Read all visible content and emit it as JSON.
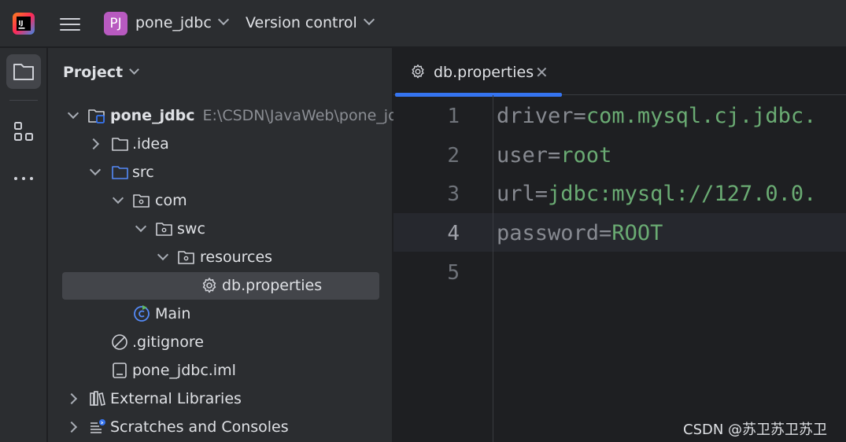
{
  "titlebar": {
    "project_badge": "PJ",
    "project_name": "pone_jdbc",
    "vcs_label": "Version control"
  },
  "stripe": {
    "items": [
      "project-folder-icon",
      "structure-icon",
      "more-icon"
    ]
  },
  "project_panel": {
    "title": "Project",
    "tree": [
      {
        "label": "pone_jdbc",
        "path": "E:\\CSDN\\JavaWeb\\pone_jdbc",
        "icon": "module-folder-icon",
        "expanded": true
      },
      {
        "label": ".idea",
        "icon": "folder-icon",
        "expanded": false
      },
      {
        "label": "src",
        "icon": "source-folder-icon",
        "expanded": true
      },
      {
        "label": "com",
        "icon": "package-icon",
        "expanded": true
      },
      {
        "label": "swc",
        "icon": "package-icon",
        "expanded": true
      },
      {
        "label": "resources",
        "icon": "package-icon",
        "expanded": true
      },
      {
        "label": "db.properties",
        "icon": "gear-icon",
        "selected": true
      },
      {
        "label": "Main",
        "icon": "java-class-icon"
      },
      {
        "label": ".gitignore",
        "icon": "gitignore-icon"
      },
      {
        "label": "pone_jdbc.iml",
        "icon": "iml-file-icon"
      },
      {
        "label": "External Libraries",
        "icon": "library-icon",
        "expanded": false
      },
      {
        "label": "Scratches and Consoles",
        "icon": "scratches-icon",
        "expanded": false
      }
    ]
  },
  "editor": {
    "tab_label": "db.properties",
    "line_numbers": [
      "1",
      "2",
      "3",
      "4",
      "5"
    ],
    "current_line": "4",
    "lines": [
      {
        "key": "driver",
        "eq": "=",
        "value": "com.mysql.cj.jdbc."
      },
      {
        "key": "user",
        "eq": "=",
        "value": "root"
      },
      {
        "key": "url",
        "eq": "=",
        "value": "jdbc:mysql://127.0.0."
      },
      {
        "key": "password",
        "eq": "=",
        "value": "ROOT"
      },
      {
        "key": "",
        "eq": "",
        "value": ""
      }
    ]
  },
  "watermark": "CSDN @苏卫苏卫苏卫",
  "colors": {
    "accent": "#3574f0",
    "key_gray": "#878a91",
    "value_green": "#6aab73",
    "panel_bg": "#2b2d30",
    "editor_bg": "#1e1f22"
  }
}
